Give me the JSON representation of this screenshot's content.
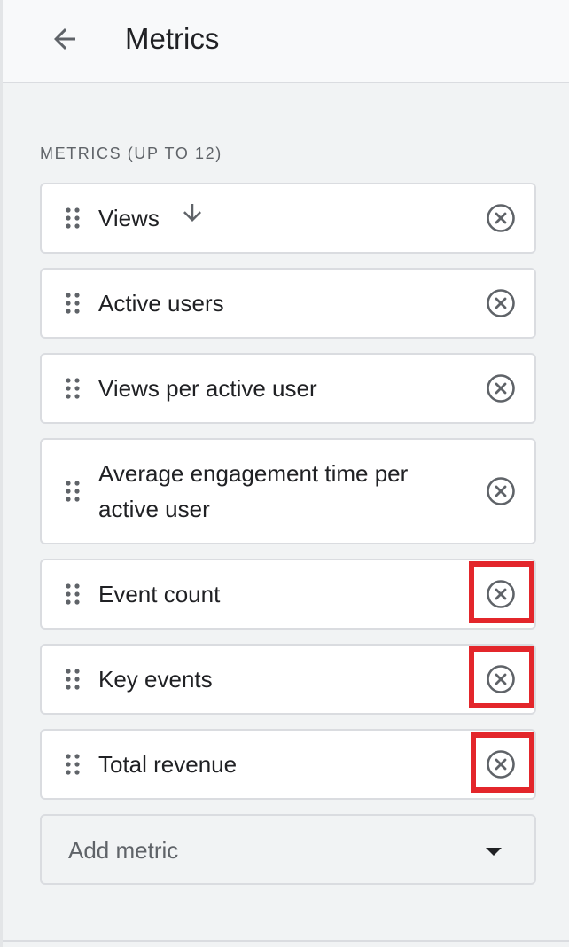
{
  "header": {
    "back_icon": "arrow-back-icon",
    "title": "Metrics"
  },
  "section": {
    "label": "METRICS (UP TO 12)"
  },
  "metrics": [
    {
      "label": "Views",
      "sorted": "descending",
      "sort_icon": "arrow-down-icon",
      "remove_icon": "cancel-circle-icon",
      "highlighted": false
    },
    {
      "label": "Active users",
      "remove_icon": "cancel-circle-icon",
      "highlighted": false
    },
    {
      "label": "Views per active user",
      "remove_icon": "cancel-circle-icon",
      "highlighted": false
    },
    {
      "label": "Average engagement time per active user",
      "remove_icon": "cancel-circle-icon",
      "highlighted": false
    },
    {
      "label": "Event count",
      "remove_icon": "cancel-circle-icon",
      "highlighted": true
    },
    {
      "label": "Key events",
      "remove_icon": "cancel-circle-icon",
      "highlighted": true
    },
    {
      "label": "Total revenue",
      "remove_icon": "cancel-circle-icon",
      "highlighted": true
    }
  ],
  "add_metric": {
    "placeholder": "Add metric",
    "icon": "caret-down-icon"
  },
  "colors": {
    "highlight": "#e3262b",
    "icon": "#5f6368",
    "text": "#202124",
    "background": "#f1f3f4"
  }
}
